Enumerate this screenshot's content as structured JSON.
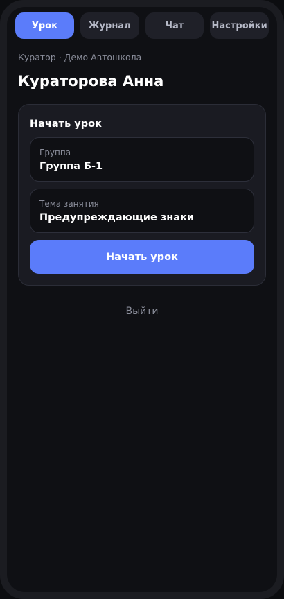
{
  "tabs": [
    {
      "label": "Урок",
      "active": true
    },
    {
      "label": "Журнал",
      "active": false
    },
    {
      "label": "Чат",
      "active": false
    },
    {
      "label": "Настройки",
      "active": false
    }
  ],
  "header": {
    "subtitle": "Куратор · Демо Автошкола",
    "title": "Кураторова Анна"
  },
  "lesson_card": {
    "title": "Начать урок",
    "group_field": {
      "label": "Группа",
      "value": "Группа Б-1"
    },
    "topic_field": {
      "label": "Тема занятия",
      "value": "Предупреждающие знаки"
    },
    "start_button_label": "Начать урок"
  },
  "logout_label": "Выйти",
  "colors": {
    "accent": "#5b7cfa",
    "background": "#0f1014",
    "card": "#1a1b22"
  }
}
